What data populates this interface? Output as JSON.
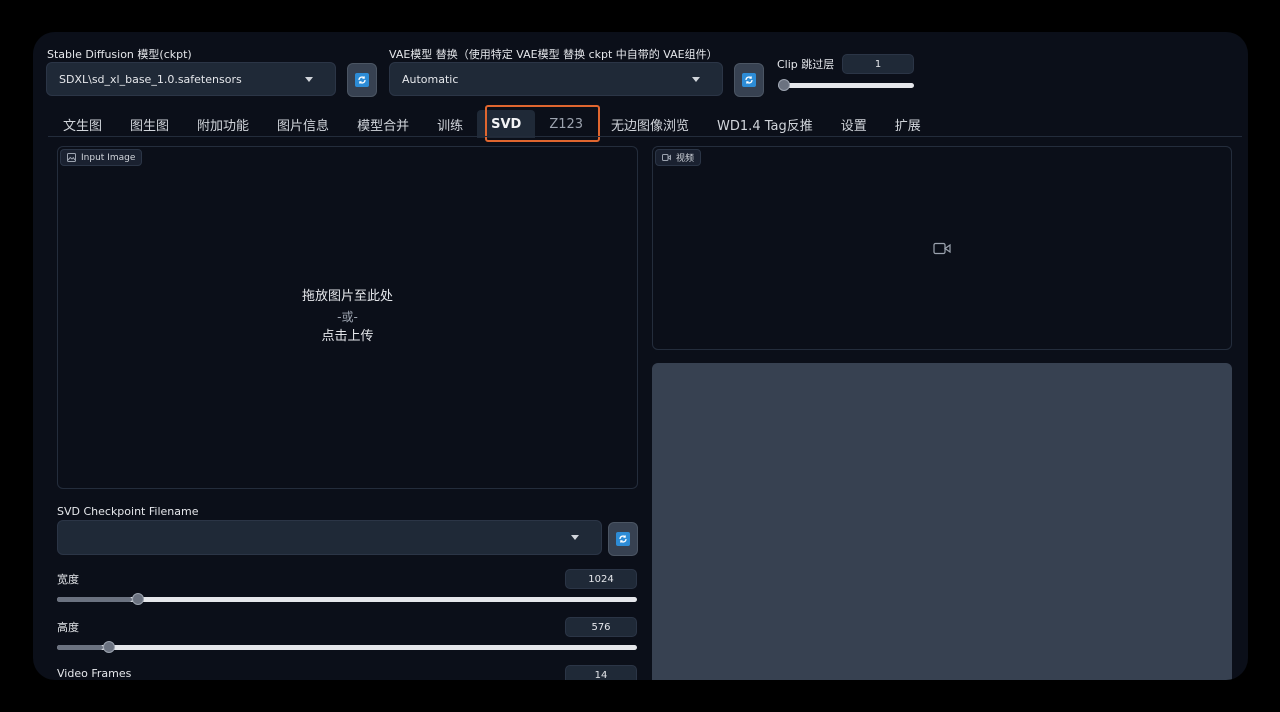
{
  "top": {
    "ckpt_label": "Stable Diffusion 模型(ckpt)",
    "ckpt_value": "SDXL\\sd_xl_base_1.0.safetensors",
    "vae_label": "VAE模型 替换（使用特定 VAE模型 替换 ckpt 中自带的 VAE组件）",
    "vae_value": "Automatic",
    "clip_label": "Clip 跳过层",
    "clip_value": "1",
    "clip_slider_fraction": 0.0
  },
  "tabs": [
    {
      "label": "文生图"
    },
    {
      "label": "图生图"
    },
    {
      "label": "附加功能"
    },
    {
      "label": "图片信息"
    },
    {
      "label": "模型合并"
    },
    {
      "label": "训练"
    },
    {
      "label": "SVD"
    },
    {
      "label": "Z123"
    },
    {
      "label": "无边图像浏览"
    },
    {
      "label": "WD1.4 Tag反推"
    },
    {
      "label": "设置"
    },
    {
      "label": "扩展"
    }
  ],
  "input_image": {
    "tag": "Input Image",
    "line1": "拖放图片至此处",
    "line2": "-或-",
    "line3": "点击上传"
  },
  "video": {
    "tag": "视频"
  },
  "svd": {
    "checkpoint_label": "SVD Checkpoint Filename",
    "checkpoint_value": ""
  },
  "width": {
    "label": "宽度",
    "value": "1024",
    "fraction": 0.13
  },
  "height": {
    "label": "高度",
    "value": "576",
    "fraction": 0.08
  },
  "frames": {
    "label": "Video Frames",
    "value": "14"
  },
  "colors": {
    "accent_highlight": "#e0662f",
    "refresh_blue": "#2d8cd6"
  },
  "icons": [
    "refresh-icon",
    "image-icon",
    "video-camera-icon"
  ]
}
